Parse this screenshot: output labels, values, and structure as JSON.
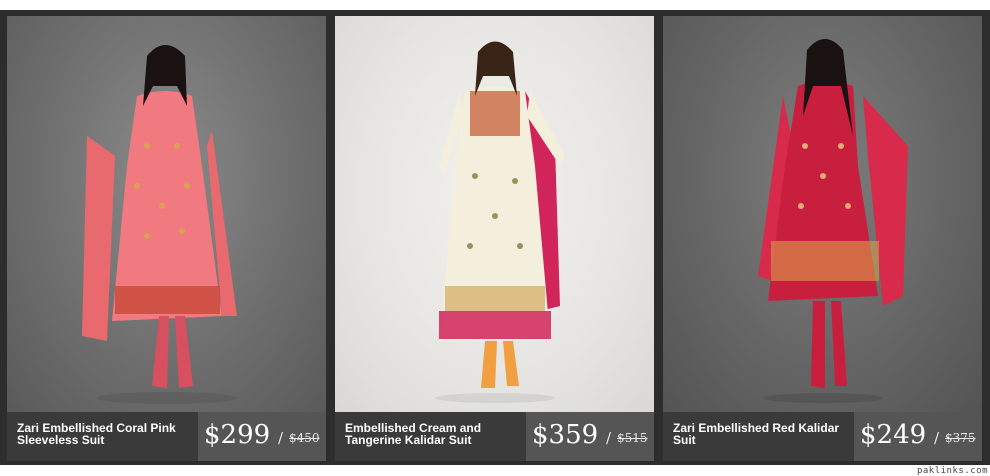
{
  "products": [
    {
      "name": "Zari Embellished Coral Pink Sleeveless Suit",
      "price": "$299",
      "separator": "/",
      "original_price": "$450",
      "dress_color": "#f0727a",
      "accent_color": "#d9a74a"
    },
    {
      "name": "Embellished Cream and Tangerine Kalidar Suit",
      "price": "$359",
      "separator": "/",
      "original_price": "$515",
      "dress_color": "#f4eedc",
      "accent_color": "#d0245a"
    },
    {
      "name": "Zari Embellished Red Kalidar Suit",
      "price": "$249",
      "separator": "/",
      "original_price": "$375",
      "dress_color": "#c81f3f",
      "accent_color": "#d9a74a"
    }
  ],
  "watermark": "paklinks.com"
}
